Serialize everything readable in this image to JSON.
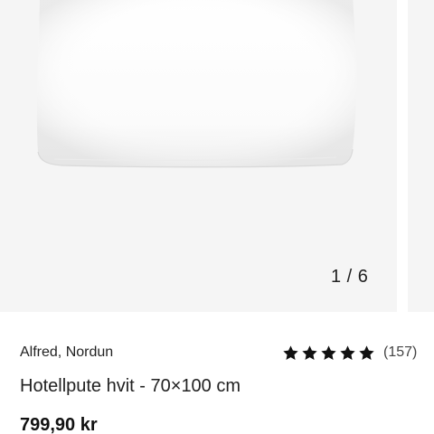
{
  "gallery": {
    "counter": "1 / 6",
    "current_index": 1,
    "total_images": 6
  },
  "product": {
    "brand": "Alfred, Nordun",
    "title": "Hotellpute hvit - 70×100 cm",
    "price": "799,90 kr",
    "rating": {
      "stars": 5,
      "max_stars": 5,
      "review_count_label": "(157)"
    }
  },
  "colors": {
    "gallery_bg": "#f5f5f5",
    "star": "#111111",
    "text": "#222222"
  },
  "icons": {
    "star": "star-icon"
  }
}
